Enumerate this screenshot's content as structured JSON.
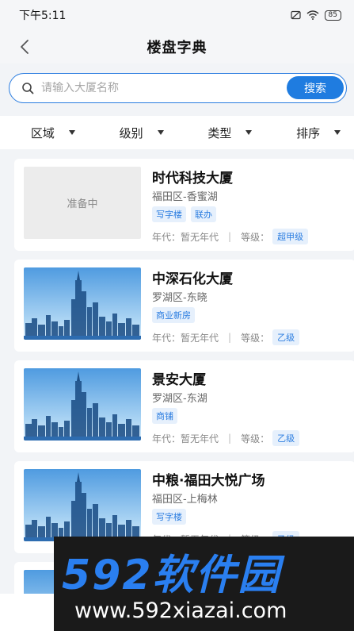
{
  "status_bar": {
    "time": "下午5:11",
    "battery": "85"
  },
  "header": {
    "title": "楼盘字典"
  },
  "search": {
    "placeholder": "请输入大厦名称",
    "button_label": "搜索"
  },
  "filters": [
    {
      "label": "区域"
    },
    {
      "label": "级别"
    },
    {
      "label": "类型"
    },
    {
      "label": "排序"
    }
  ],
  "meta_labels": {
    "year_prefix": "年代：",
    "level_prefix": "等级："
  },
  "buildings": [
    {
      "name": "时代科技大厦",
      "location": "福田区-香蜜湖",
      "tags": [
        "写字楼",
        "联办"
      ],
      "year": "暂无年代",
      "level": "超甲级",
      "image": "准备中"
    },
    {
      "name": "中深石化大厦",
      "location": "罗湖区-东晓",
      "tags": [
        "商业新房"
      ],
      "year": "暂无年代",
      "level": "乙级",
      "image": "skyline"
    },
    {
      "name": "景安大厦",
      "location": "罗湖区-东湖",
      "tags": [
        "商铺"
      ],
      "year": "暂无年代",
      "level": "乙级",
      "image": "skyline"
    },
    {
      "name": "中粮·福田大悦广场",
      "location": "福田区-上梅林",
      "tags": [
        "写字楼"
      ],
      "year": "暂无年代",
      "level": "乙级",
      "image": "skyline"
    }
  ],
  "watermark": {
    "brand": "592软件园",
    "url": "www.592xiazai.com"
  },
  "colors": {
    "accent": "#1f7ce0",
    "tag_bg": "#e6f0fc",
    "page_bg": "#f2f4f7"
  }
}
